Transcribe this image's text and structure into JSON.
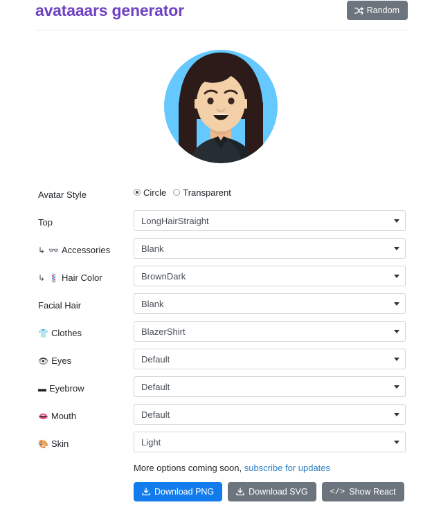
{
  "header": {
    "title": "avataaars generator",
    "random_button": "Random",
    "random_icon": "shuffle-icon"
  },
  "avatar": {
    "alt": "generated avatar preview",
    "background_color": "#65C9FF",
    "hair_color": "#2C1B18",
    "skin_color": "#F8D2B0",
    "clothes_color": "#262E33",
    "style": "Circle",
    "top": "LongHairStraight",
    "clothes": "BlazerShirt"
  },
  "form": {
    "avatar_style": {
      "label": "Avatar Style",
      "options": [
        "Circle",
        "Transparent"
      ],
      "selected": "Circle"
    },
    "fields": [
      {
        "label": "Top",
        "icon": "",
        "sub": false,
        "value": "LongHairStraight"
      },
      {
        "label": "Accessories",
        "icon": "👓",
        "sub": true,
        "value": "Blank"
      },
      {
        "label": "Hair Color",
        "icon": "💈",
        "sub": true,
        "value": "BrownDark"
      },
      {
        "label": "Facial Hair",
        "icon": "",
        "sub": false,
        "value": "Blank"
      },
      {
        "label": "Clothes",
        "icon": "👕",
        "sub": false,
        "value": "BlazerShirt"
      },
      {
        "label": "Eyes",
        "icon": "👁",
        "sub": false,
        "value": "Default"
      },
      {
        "label": "Eyebrow",
        "icon": "▬",
        "sub": false,
        "value": "Default"
      },
      {
        "label": "Mouth",
        "icon": "👄",
        "sub": false,
        "value": "Default"
      },
      {
        "label": "Skin",
        "icon": "🎨",
        "sub": false,
        "value": "Light"
      }
    ]
  },
  "footer": {
    "note_text": "More options coming soon,",
    "note_link": "subscribe for updates",
    "buttons": [
      {
        "label": "Download PNG",
        "icon": "download-icon",
        "style": "primary"
      },
      {
        "label": "Download SVG",
        "icon": "download-icon",
        "style": "secondary"
      },
      {
        "label": "Show React",
        "icon": "code-icon",
        "style": "secondary"
      }
    ]
  },
  "colors": {
    "brand_purple": "#6f42c1",
    "primary_blue": "#137cec",
    "secondary_gray": "#6c757d",
    "link_blue": "#2a7fc9"
  }
}
